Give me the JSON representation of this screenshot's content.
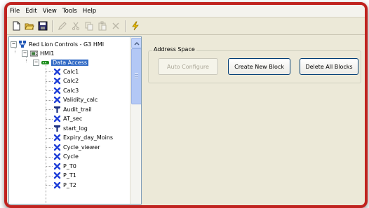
{
  "menu": {
    "items": [
      {
        "label": "File"
      },
      {
        "label": "Edit"
      },
      {
        "label": "View"
      },
      {
        "label": "Tools"
      },
      {
        "label": "Help"
      }
    ]
  },
  "toolbar": {
    "buttons": [
      {
        "icon": "new-file-icon"
      },
      {
        "icon": "open-folder-icon"
      },
      {
        "icon": "save-icon"
      },
      {
        "icon": "edit-pencil-icon"
      },
      {
        "icon": "cut-icon"
      },
      {
        "icon": "copy-icon"
      },
      {
        "icon": "paste-icon"
      },
      {
        "icon": "delete-icon"
      },
      {
        "icon": "lightning-icon"
      }
    ]
  },
  "tree": {
    "root": {
      "label": "Red Lion Controls - G3 HMI",
      "icon": "network-icon"
    },
    "hmi": {
      "label": "HMI1",
      "icon": "hmi-device-icon"
    },
    "data_access": {
      "label": "Data Access",
      "icon": "green-node-icon"
    },
    "items": [
      {
        "label": "Calc1",
        "icon": "x-tag-icon"
      },
      {
        "label": "Calc2",
        "icon": "x-tag-icon"
      },
      {
        "label": "Calc3",
        "icon": "x-tag-icon"
      },
      {
        "label": "Validity_calc",
        "icon": "x-tag-icon"
      },
      {
        "label": "Audit_trail",
        "icon": "t-tag-icon"
      },
      {
        "label": "AT_sec",
        "icon": "x-tag-icon"
      },
      {
        "label": "start_log",
        "icon": "t-tag-icon"
      },
      {
        "label": "Expiry_day_Moins",
        "icon": "x-tag-icon"
      },
      {
        "label": "Cycle_viewer",
        "icon": "x-tag-icon"
      },
      {
        "label": "Cycle",
        "icon": "x-tag-icon"
      },
      {
        "label": "P_T0",
        "icon": "x-tag-icon"
      },
      {
        "label": "P_T1",
        "icon": "x-tag-icon"
      },
      {
        "label": "P_T2",
        "icon": "x-tag-icon"
      }
    ]
  },
  "address_space": {
    "title": "Address Space",
    "auto_configure": "Auto Configure",
    "create_new_block": "Create New Block",
    "delete_all_blocks": "Delete All Blocks"
  },
  "colors": {
    "frame_border": "#c0231f",
    "selection": "#316ac5",
    "x_tag": "#1f3fd8"
  }
}
